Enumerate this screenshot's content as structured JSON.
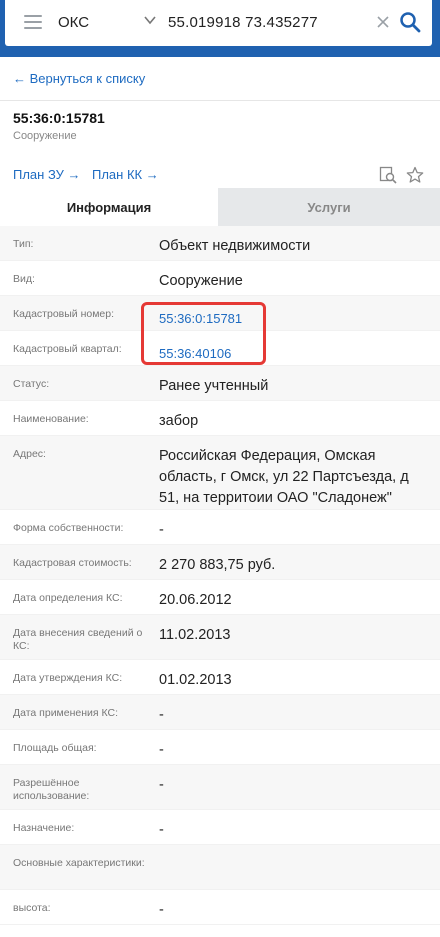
{
  "search": {
    "type_value": "ОКС",
    "query_value": "55.019918 73.435277"
  },
  "nav": {
    "back_label": "← Вернуться к списку"
  },
  "object": {
    "title": "55:36:0:15781",
    "subtitle": "Сооружение"
  },
  "links": {
    "plan_zu": "План ЗУ →",
    "plan_kk": "План КК →"
  },
  "tabs": [
    {
      "label": "Информация",
      "active": true
    },
    {
      "label": "Услуги",
      "active": false
    }
  ],
  "rows": [
    {
      "label": "Тип:",
      "value": "Объект недвижимости"
    },
    {
      "label": "Вид:",
      "value": "Сооружение"
    },
    {
      "label": "Кадастровый номер:",
      "value": "55:36:0:15781",
      "link": true
    },
    {
      "label": "Кадастровый квартал:",
      "value": "55:36:40106",
      "link": true
    },
    {
      "label": "Статус:",
      "value": "Ранее учтенный"
    },
    {
      "label": "Наименование:",
      "value": "забор"
    },
    {
      "label": "Адрес:",
      "value": "Российская Федерация, Омская область, г Омск, ул 22 Партсъезда, д 51, на территоии ОАО \"Сладонеж\""
    },
    {
      "label": "Форма собственности:",
      "value": "-"
    },
    {
      "label": "Кадастровая стоимость:",
      "value": "2 270 883,75 руб."
    },
    {
      "label": "Дата определения КС:",
      "value": "20.06.2012"
    },
    {
      "label": "Дата внесения сведений о КС:",
      "value": "11.02.2013"
    },
    {
      "label": "Дата утверждения КС:",
      "value": "01.02.2013"
    },
    {
      "label": "Дата применения КС:",
      "value": "-"
    },
    {
      "label": "Площадь общая:",
      "value": "-"
    },
    {
      "label": "Разрешённое использование:",
      "value": "-"
    },
    {
      "label": "Назначение:",
      "value": "-"
    },
    {
      "label": "Основные характеристики:",
      "value": ""
    },
    {
      "label": "высота:",
      "value": "-"
    }
  ],
  "colors": {
    "header_blue": "#1f61b0",
    "link_blue": "#1e6bc1",
    "highlight_red": "#e53935"
  }
}
